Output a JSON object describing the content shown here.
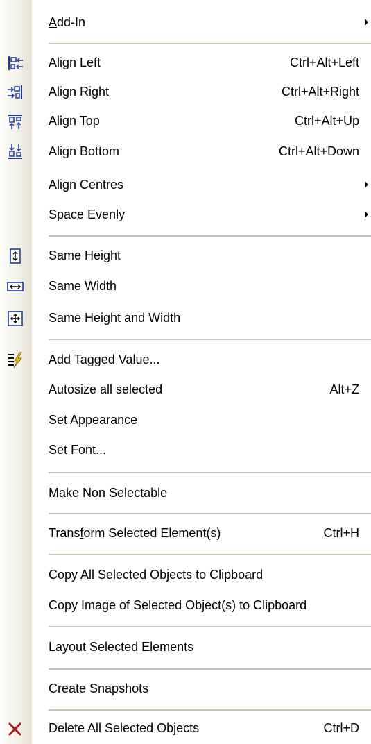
{
  "menu": {
    "add_in": {
      "before": "",
      "mnemonic": "A",
      "after": "dd-In"
    },
    "align_left": {
      "label": "Align Left",
      "shortcut": "Ctrl+Alt+Left",
      "icon": "align-left-icon"
    },
    "align_right": {
      "label": "Align Right",
      "shortcut": "Ctrl+Alt+Right",
      "icon": "align-right-icon"
    },
    "align_top": {
      "label": "Align Top",
      "shortcut": "Ctrl+Alt+Up",
      "icon": "align-top-icon"
    },
    "align_bottom": {
      "label": "Align Bottom",
      "shortcut": "Ctrl+Alt+Down",
      "icon": "align-bottom-icon"
    },
    "align_centres": {
      "label": "Align Centres"
    },
    "space_evenly": {
      "label": "Space Evenly"
    },
    "same_height": {
      "label": "Same Height",
      "icon": "same-height-icon"
    },
    "same_width": {
      "label": "Same Width",
      "icon": "same-width-icon"
    },
    "same_height_width": {
      "label": "Same Height and Width",
      "icon": "same-height-and-width-icon"
    },
    "add_tagged_value": {
      "label": "Add Tagged Value...",
      "icon": "tagged-value-icon"
    },
    "autosize": {
      "label": "Autosize all selected",
      "shortcut": "Alt+Z"
    },
    "set_appearance": {
      "label": "Set Appearance"
    },
    "set_font": {
      "before": "",
      "mnemonic": "S",
      "after": "et Font..."
    },
    "make_non_selectable": {
      "label": "Make Non Selectable"
    },
    "transform": {
      "before": "Trans",
      "mnemonic": "f",
      "after": "orm Selected Element(s)",
      "shortcut": "Ctrl+H"
    },
    "copy_all": {
      "label": "Copy All Selected Objects to Clipboard"
    },
    "copy_image": {
      "label": "Copy Image of Selected Object(s) to Clipboard"
    },
    "layout": {
      "label": "Layout Selected Elements"
    },
    "snapshots": {
      "label": "Create Snapshots"
    },
    "delete": {
      "label": "Delete All Selected Objects",
      "shortcut": "Ctrl+D",
      "icon": "delete-x-icon"
    }
  },
  "colors": {
    "icon_blue": "#1f3c99",
    "delete_red": "#b01818",
    "tag_yellow": "#f1c40f",
    "separator": "#c5c2b2",
    "icon_bar_end": "#e4e1d2"
  }
}
